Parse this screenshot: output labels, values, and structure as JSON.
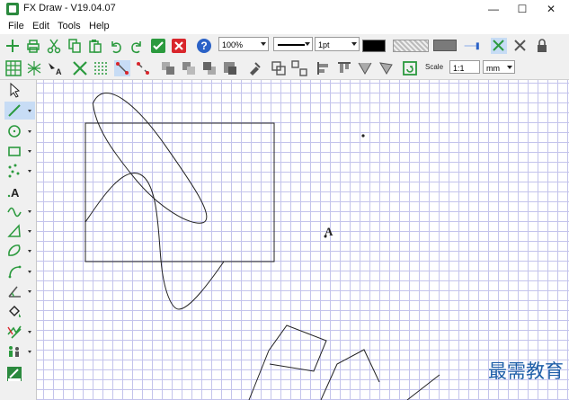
{
  "window": {
    "title": "FX Draw - V19.04.07",
    "controls": [
      "minimize-icon",
      "maximize-icon",
      "close-icon"
    ]
  },
  "menu": [
    "File",
    "Edit",
    "Tools",
    "Help"
  ],
  "toolbar1": {
    "zoom_value": "100%",
    "line_width_value": "1pt",
    "color_line": "#000000"
  },
  "toolbar2": {
    "scale_label": "Scale",
    "scale_value": "1:1",
    "unit_value": "mm"
  },
  "canvas": {
    "point_label": "A"
  },
  "watermark": "最需教育",
  "colors": {
    "accent_green": "#2b9a3e",
    "accent_red": "#d9262c",
    "accent_blue": "#2b62c7",
    "grid": "#c4c4ec"
  }
}
